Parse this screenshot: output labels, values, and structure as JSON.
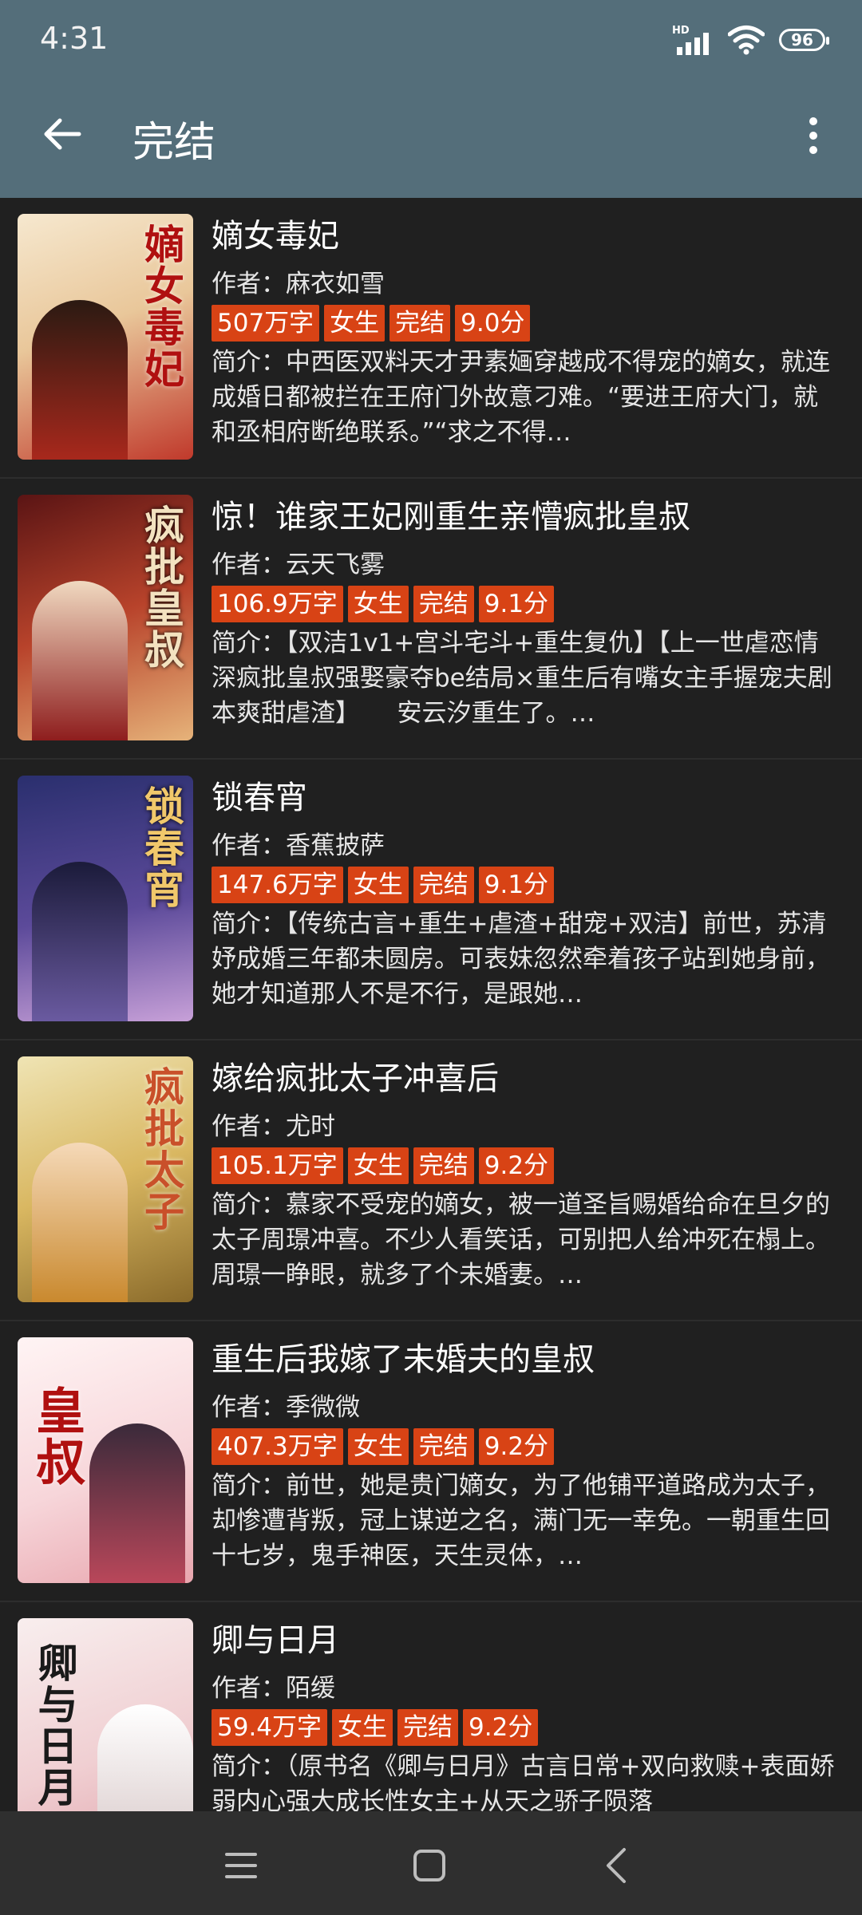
{
  "status_bar": {
    "time": "4:31",
    "network_label": "HD",
    "battery": "96"
  },
  "app_bar": {
    "title": "完结",
    "back_icon": "arrow-left-icon",
    "more_icon": "more-vertical-icon"
  },
  "books": [
    {
      "title": "嫡女毒妃",
      "author": "作者：麻衣如雪",
      "words": "507万字",
      "gender": "女生",
      "status": "完结",
      "score": "9.0分",
      "intro": "简介：中西医双料天才尹素婳穿越成不得宠的嫡女，就连成婚日都被拦在王府门外故意刁难。“要进王府大门，就和丞相府断绝联系。”“求之不得…",
      "cover_text": "嫡女毒妃",
      "cover_colors": [
        "#f3e3c8",
        "#c0392b"
      ]
    },
    {
      "title": "惊！谁家王妃刚重生亲懵疯批皇叔",
      "author": "作者：云天飞雾",
      "words": "106.9万字",
      "gender": "女生",
      "status": "完结",
      "score": "9.1分",
      "intro": "简介：【双洁1v1+宫斗宅斗+重生复仇】【上一世虐恋情深疯批皇叔强娶豪夺be结局×重生后有嘴女主手握宠夫剧本爽甜虐渣】　　安云汐重生了。…",
      "cover_text": "疯批皇叔",
      "cover_colors": [
        "#7a1f1f",
        "#d35a3a"
      ]
    },
    {
      "title": "锁春宵",
      "author": "作者：香蕉披萨",
      "words": "147.6万字",
      "gender": "女生",
      "status": "完结",
      "score": "9.1分",
      "intro": "简介：【传统古言+重生+虐渣+甜宠+双洁】前世，苏清妤成婚三年都未圆房。可表妹忽然牵着孩子站到她身前，她才知道那人不是不行，是跟她…",
      "cover_text": "锁春宵",
      "cover_colors": [
        "#3b3f8f",
        "#7d5aa6"
      ]
    },
    {
      "title": "嫁给疯批太子冲喜后",
      "author": "作者：尤时",
      "words": "105.1万字",
      "gender": "女生",
      "status": "完结",
      "score": "9.2分",
      "intro": "简介：慕家不受宠的嫡女，被一道圣旨赐婚给命在旦夕的太子周璟冲喜。不少人看笑话，可别把人给冲死在榻上。周璟一睁眼，就多了个未婚妻。…",
      "cover_text": "疯批太子",
      "cover_colors": [
        "#e9d9a3",
        "#c9892e"
      ]
    },
    {
      "title": "重生后我嫁了未婚夫的皇叔",
      "author": "作者：季微微",
      "words": "407.3万字",
      "gender": "女生",
      "status": "完结",
      "score": "9.2分",
      "intro": "简介：前世，她是贵门嫡女，为了他铺平道路成为太子，却惨遭背叛，冠上谋逆之名，满门无一幸免。一朝重生回十七岁，鬼手神医，天生灵体，…",
      "cover_text": "皇叔",
      "cover_colors": [
        "#fbeef0",
        "#c8202e"
      ]
    },
    {
      "title": "卿与日月",
      "author": "作者：陌缓",
      "words": "59.4万字",
      "gender": "女生",
      "status": "完结",
      "score": "9.2分",
      "intro": "简介：（原书名《卿与日月》古言日常+双向救赎+表面娇弱内心强大成长性女主+从天之骄子陨落",
      "cover_text": "卿与日月",
      "cover_colors": [
        "#f7ecec",
        "#e8a0a8"
      ]
    }
  ],
  "nav_bar": {
    "menu_icon": "menu-icon",
    "home_icon": "home-square-icon",
    "back_icon": "back-chevron-icon"
  }
}
